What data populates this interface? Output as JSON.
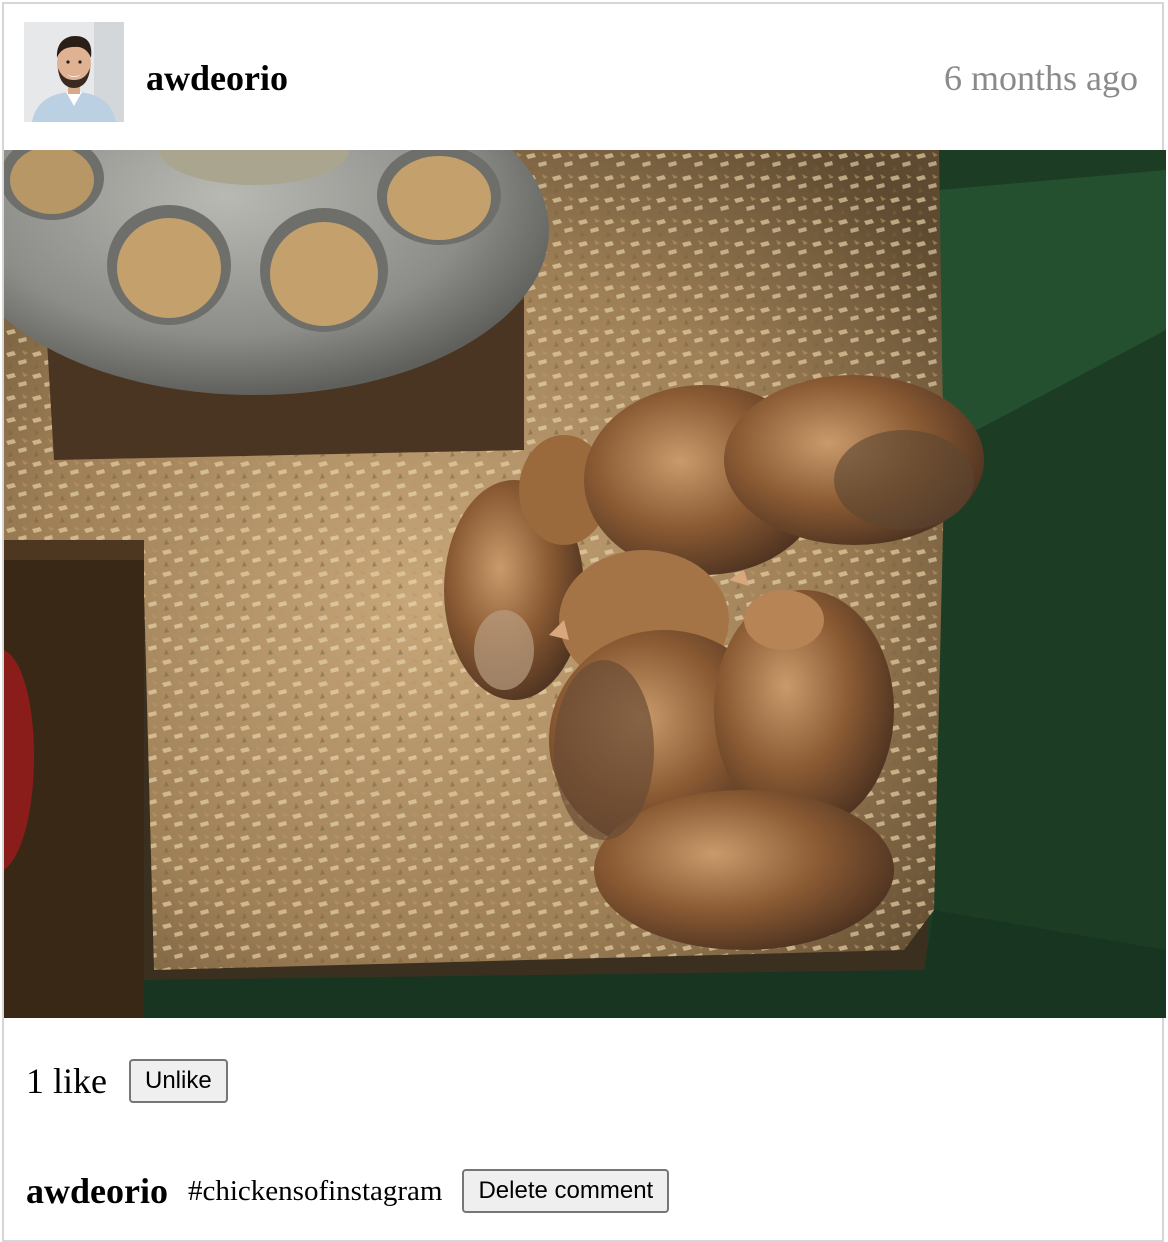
{
  "post": {
    "owner": "awdeorio",
    "timestamp": "6 months ago",
    "likes_text": "1 like",
    "like_button_label": "Unlike"
  },
  "comments": [
    {
      "owner": "awdeorio",
      "text": "#chickensofinstagram",
      "delete_label": "Delete comment"
    }
  ]
}
